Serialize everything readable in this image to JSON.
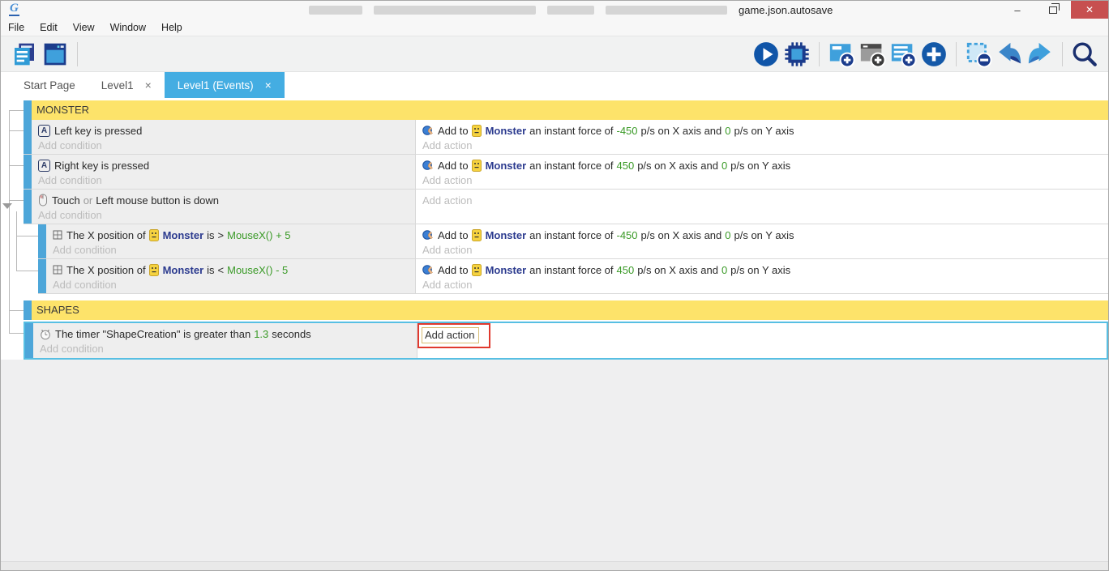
{
  "window": {
    "title": "game.json.autosave",
    "minimize_glyph": "–",
    "close_glyph": "✕"
  },
  "menu": {
    "file": "File",
    "edit": "Edit",
    "view": "View",
    "window": "Window",
    "help": "Help"
  },
  "tabs": {
    "start_page": "Start Page",
    "level1": "Level1",
    "level1_events": "Level1 (Events)",
    "close_glyph": "×"
  },
  "toolbar": {
    "icons": [
      "new-project",
      "open-scene",
      "play",
      "debug",
      "add-event",
      "add-sub-event",
      "add-comment",
      "add-other",
      "delete-selection",
      "undo",
      "redo",
      "search"
    ]
  },
  "labels": {
    "add_condition": "Add condition",
    "add_action": "Add action"
  },
  "groups": {
    "monster": "MONSTER",
    "shapes": "SHAPES"
  },
  "conditions": {
    "left_key": {
      "text": "Left key is pressed"
    },
    "right_key": {
      "text": "Right key is pressed"
    },
    "touch": {
      "t1": "Touch",
      "t2": "or",
      "t3": "Left mouse button is down"
    },
    "xpos_gt": {
      "t1": "The X position of",
      "obj": "Monster",
      "t2": "is",
      "op": ">",
      "expr": "MouseX() + 5"
    },
    "xpos_lt": {
      "t1": "The X position of",
      "obj": "Monster",
      "t2": "is",
      "op": "<",
      "expr": "MouseX() - 5"
    },
    "timer": {
      "t1": "The timer \"ShapeCreation\" is greater than",
      "value": "1.3",
      "t2": "seconds"
    }
  },
  "actions": {
    "force_left": {
      "t1": "Add to",
      "obj": "Monster",
      "t2": "an instant force of",
      "x": "-450",
      "t3": "p/s on X axis and",
      "y": "0",
      "t4": "p/s on Y axis"
    },
    "force_right": {
      "t1": "Add to",
      "obj": "Monster",
      "t2": "an instant force of",
      "x": "450",
      "t3": "p/s on X axis and",
      "y": "0",
      "t4": "p/s on Y axis"
    }
  },
  "colors": {
    "accent_blue": "#44ade2",
    "group_yellow": "#fde36a",
    "event_bar_blue": "#4da6d9",
    "green_value": "#3a9a27",
    "object_navy": "#2c3b8f",
    "selected_border": "#57bfe3",
    "annotation_red": "#e0392e",
    "close_red": "#c75050"
  }
}
